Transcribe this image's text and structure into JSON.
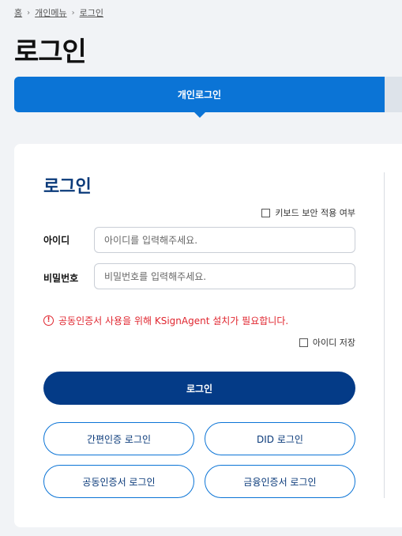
{
  "breadcrumb": {
    "home": "홈",
    "menu": "개인메뉴",
    "current": "로그인"
  },
  "page_title": "로그인",
  "tabs": {
    "active": "개인로그인"
  },
  "card": {
    "title": "로그인",
    "keyboard_security_label": "키보드 보안 적용 여부",
    "id_label": "아이디",
    "id_placeholder": "아이디를 입력해주세요.",
    "password_label": "비밀번호",
    "password_placeholder": "비밀번호를 입력해주세요.",
    "warning": "공동인증서 사용을 위해 KSignAgent 설치가 필요합니다.",
    "save_id_label": "아이디 저장",
    "login_button": "로그인",
    "simple_auth_button": "간편인증 로그인",
    "did_button": "DID 로그인",
    "joint_cert_button": "공동인증서 로그인",
    "financial_cert_button": "금융인증서 로그인"
  },
  "colors": {
    "primary": "#0b74d6",
    "dark_button": "#043b87",
    "warning": "#e0262f"
  },
  "icons": {
    "breadcrumb_separator": "chevron-right-icon",
    "warning": "exclamation-circle-icon"
  }
}
